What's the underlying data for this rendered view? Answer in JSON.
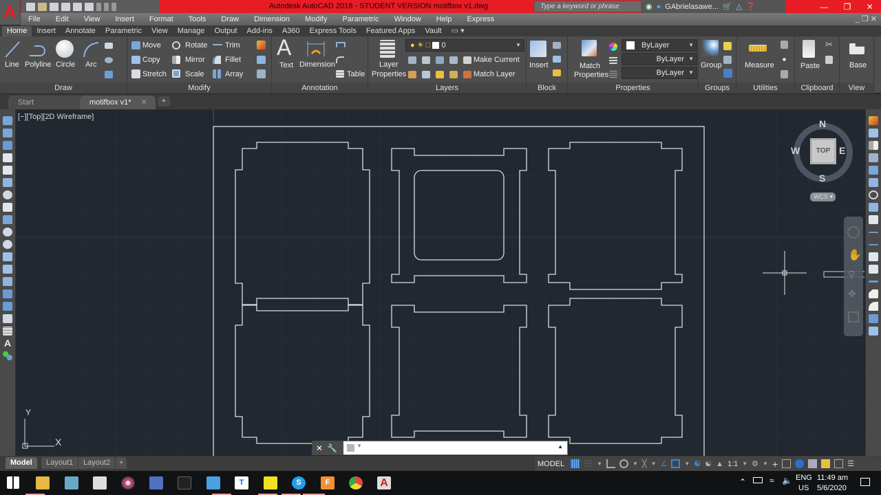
{
  "app": {
    "logo_letter": "A",
    "title": "Autodesk AutoCAD 2018 - STUDENT VERSION    motifbox v1.dwg",
    "search_placeholder": "Type a keyword or phrase",
    "user": "GAbrielasawe...",
    "accent_color": "#e81c24"
  },
  "menubar": [
    "File",
    "Edit",
    "View",
    "Insert",
    "Format",
    "Tools",
    "Draw",
    "Dimension",
    "Modify",
    "Parametric",
    "Window",
    "Help",
    "Express"
  ],
  "ribbon_tabs": [
    "Home",
    "Insert",
    "Annotate",
    "Parametric",
    "View",
    "Manage",
    "Output",
    "Add-ins",
    "A360",
    "Express Tools",
    "Featured Apps",
    "Vault"
  ],
  "ribbon": {
    "draw": {
      "label": "Draw",
      "line": "Line",
      "polyline": "Polyline",
      "circle": "Circle",
      "arc": "Arc"
    },
    "modify": {
      "label": "Modify",
      "move": "Move",
      "rotate": "Rotate",
      "trim": "Trim",
      "copy": "Copy",
      "mirror": "Mirror",
      "fillet": "Fillet",
      "stretch": "Stretch",
      "scale": "Scale",
      "array": "Array"
    },
    "annotation": {
      "label": "Annotation",
      "text": "Text",
      "dimension": "Dimension",
      "table": "Table"
    },
    "layers": {
      "label": "Layers",
      "layer_properties_1": "Layer",
      "layer_properties_2": "Properties",
      "current_layer": "0",
      "make_current": "Make Current",
      "match_layer": "Match Layer"
    },
    "block": {
      "label": "Block",
      "insert": "Insert"
    },
    "properties": {
      "label": "Properties",
      "match_1": "Match",
      "match_2": "Properties",
      "color": "ByLayer",
      "linetype": "ByLayer",
      "lineweight": "ByLayer"
    },
    "groups": {
      "label": "Groups",
      "group": "Group"
    },
    "utilities": {
      "label": "Utilities",
      "measure": "Measure"
    },
    "clipboard": {
      "label": "Clipboard",
      "paste": "Paste"
    },
    "view": {
      "label": "View",
      "base": "Base"
    }
  },
  "file_tabs": [
    {
      "label": "Start"
    },
    {
      "label": "motifbox v1*",
      "active": true
    }
  ],
  "viewport": {
    "label": "[−][Top][2D Wireframe]",
    "viewcube": {
      "top": "TOP",
      "n": "N",
      "s": "S",
      "e": "E",
      "w": "W",
      "ucs": "WCS"
    },
    "ucs_x": "X",
    "ucs_y": "Y"
  },
  "layout_tabs": [
    {
      "label": "Model",
      "active": true
    },
    {
      "label": "Layout1"
    },
    {
      "label": "Layout2"
    }
  ],
  "statusbar": {
    "model": "MODEL",
    "scale": "1:1"
  },
  "taskbar": {
    "apps": [
      "start",
      "file-explorer",
      "notepad",
      "chat",
      "media",
      "network",
      "terminal",
      "remote",
      "typora",
      "sticky-notes",
      "skype",
      "fusion",
      "chrome",
      "autocad"
    ],
    "lang1": "ENG",
    "lang2": "US",
    "time": "11:49 am",
    "date": "5/6/2020"
  }
}
